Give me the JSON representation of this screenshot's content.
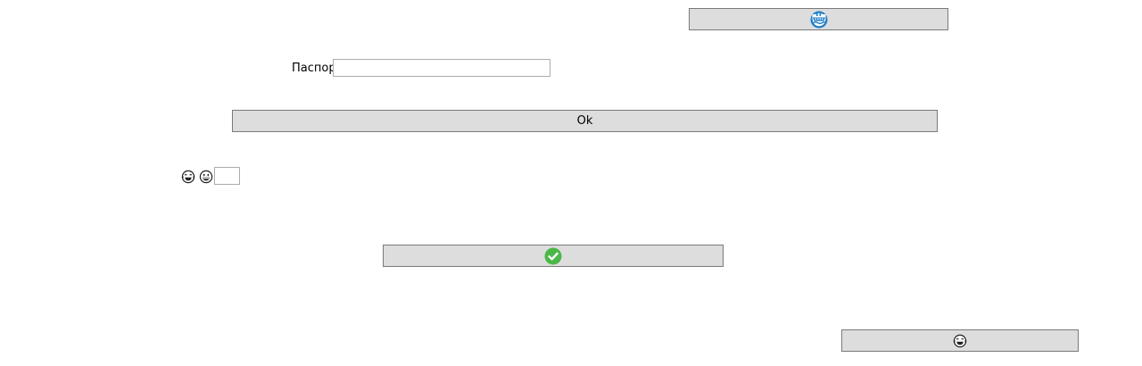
{
  "top_button": {
    "icon": "ship-icon",
    "color": "#1e7ec8"
  },
  "passport": {
    "label": "Паспорт",
    "value": "",
    "placeholder": ""
  },
  "ok_button": {
    "label": "Ok"
  },
  "emoji_row": {
    "icons": [
      "tears-of-joy-emoji-icon",
      "grinning-emoji-icon"
    ],
    "input_value": ""
  },
  "check_button": {
    "icon": "check-circle-icon",
    "color": "#4cb748"
  },
  "bottom_button": {
    "icon": "tears-of-joy-emoji-icon"
  }
}
